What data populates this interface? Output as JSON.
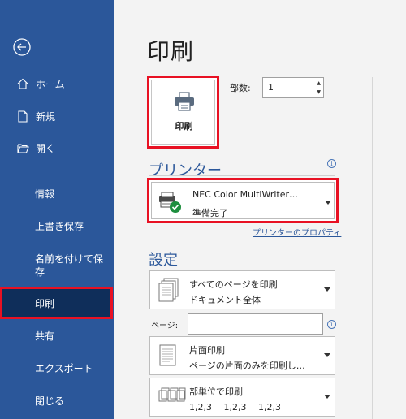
{
  "sidebar": {
    "items": [
      {
        "label": "ホーム"
      },
      {
        "label": "新規"
      },
      {
        "label": "開く"
      },
      {
        "label": "情報"
      },
      {
        "label": "上書き保存"
      },
      {
        "label": "名前を付けて保存"
      },
      {
        "label": "印刷"
      },
      {
        "label": "共有"
      },
      {
        "label": "エクスポート"
      },
      {
        "label": "閉じる"
      }
    ]
  },
  "main": {
    "title": "印刷",
    "print_button_label": "印刷",
    "copies_label": "部数:",
    "copies_value": "1",
    "printer_section_title": "プリンター",
    "printer_name": "NEC Color MultiWriter…",
    "printer_status": "準備完了",
    "printer_properties_link": "プリンターのプロパティ",
    "settings_section_title": "設定",
    "print_range_line1": "すべてのページを印刷",
    "print_range_line2": "ドキュメント全体",
    "pages_label": "ページ:",
    "pages_value": "",
    "sides_line1": "片面印刷",
    "sides_line2": "ページの片面のみを印刷し…",
    "collate_line1": "部単位で印刷",
    "collate_line2": "1,2,3　 1,2,3　 1,2,3"
  },
  "colors": {
    "sidebar_bg": "#2b579a",
    "selected_bg": "#0f2e5a",
    "highlight": "#e81123",
    "accent": "#2b579a"
  }
}
